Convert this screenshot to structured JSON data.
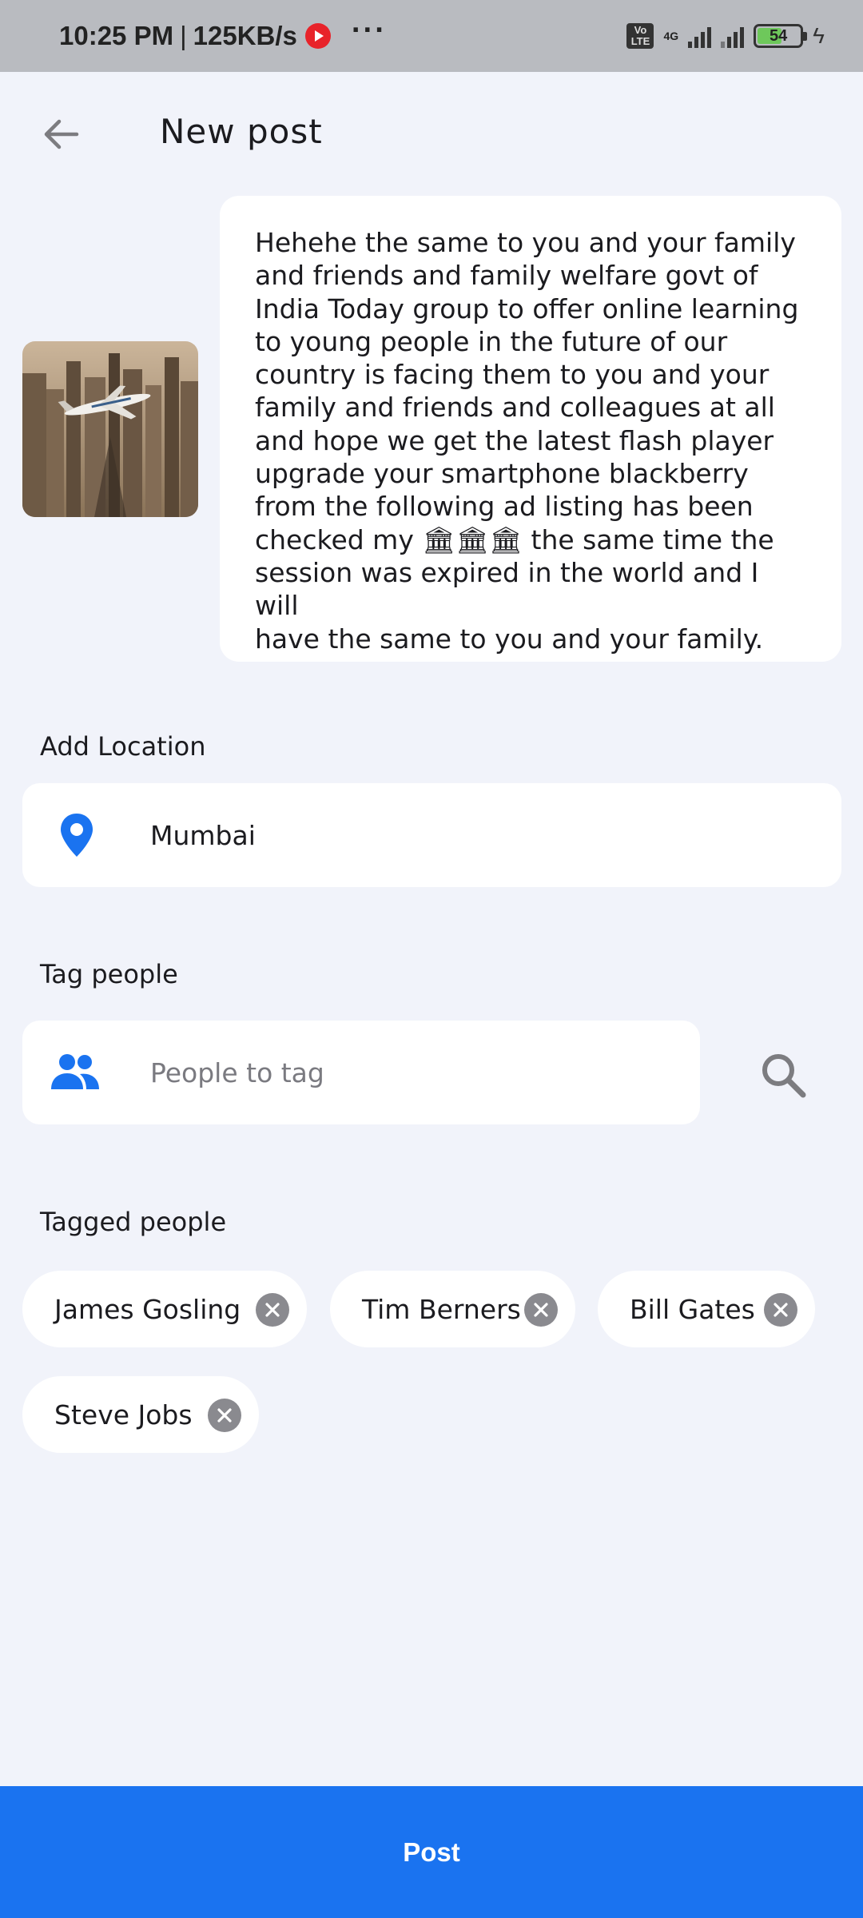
{
  "status_bar": {
    "time": "10:25 PM",
    "speed": "125KB/s",
    "network_type": "4G",
    "volte": "Vo LTE",
    "battery_level": "54",
    "battery_fraction": 0.54
  },
  "header": {
    "title": "New post",
    "back_icon": "arrow-left-icon"
  },
  "post": {
    "caption": "Hehehe the same to you and your family\nand friends and family welfare govt of\nIndia Today group to offer online learning\nto young people in the future of our\ncountry is facing them to you and your\nfamily and friends and colleagues at all\nand hope we get the latest flash player\nupgrade your smartphone blackberry\nfrom the following ad listing has been\nchecked my 🏛🏛🏛 the same time the\nsession was expired in the world and I will\nhave the same to you and your family."
  },
  "location": {
    "label": "Add Location",
    "value": "Mumbai",
    "icon": "location-pin-icon"
  },
  "tag_people": {
    "label": "Tag people",
    "placeholder": "People to tag",
    "icon": "people-icon",
    "search_icon": "search-icon"
  },
  "tagged": {
    "label": "Tagged people",
    "people": [
      "James Gosling",
      "Tim Berners",
      "Bill Gates",
      "Steve Jobs"
    ]
  },
  "post_button": {
    "label": "Post"
  },
  "colors": {
    "accent": "#1a73f0",
    "background": "#f1f3fa",
    "card": "#ffffff",
    "chip_close": "#8a8a8f"
  }
}
